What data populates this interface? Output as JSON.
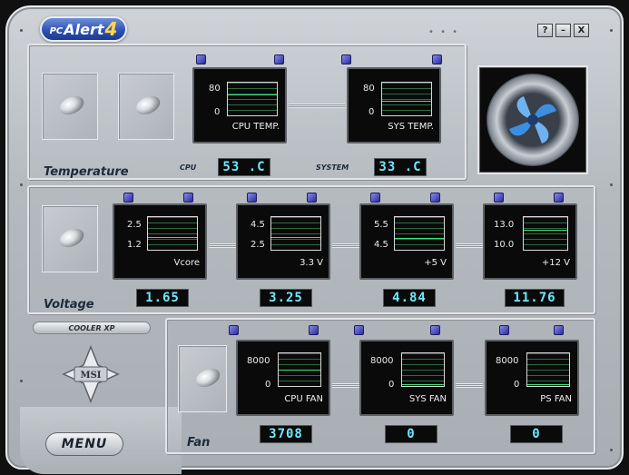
{
  "app": {
    "logo_prefix": "PC",
    "logo_name": "Alert",
    "logo_version": "4",
    "help_label": "?",
    "minimize_label": "–",
    "close_label": "X"
  },
  "temperature": {
    "title": "Temperature",
    "cpu_caption": "CPU",
    "system_caption": "SYSTEM",
    "monitors": [
      {
        "hi": "80",
        "lo": "0",
        "label": "CPU TEMP.",
        "trace_level": 0.62
      },
      {
        "hi": "80",
        "lo": "0",
        "label": "SYS TEMP.",
        "trace_level": 0.41
      }
    ],
    "cpu_value": "53 .C",
    "system_value": "33 .C"
  },
  "voltage": {
    "title": "Voltage",
    "monitors": [
      {
        "hi": "2.5",
        "lo": "1.2",
        "label": "Vcore",
        "value": "1.65",
        "trace_level": 0.35
      },
      {
        "hi": "4.5",
        "lo": "2.5",
        "label": "3.3 V",
        "value": "3.25",
        "trace_level": 0.37
      },
      {
        "hi": "5.5",
        "lo": "4.5",
        "label": "+5 V",
        "value": "4.84",
        "trace_level": 0.34
      },
      {
        "hi": "13.0",
        "lo": "10.0",
        "label": "+12 V",
        "value": "11.76",
        "trace_level": 0.58
      }
    ]
  },
  "fan": {
    "title": "Fan",
    "monitors": [
      {
        "hi": "8000",
        "lo": "0",
        "label": "CPU FAN",
        "value": "3708",
        "trace_level": 0.46
      },
      {
        "hi": "8000",
        "lo": "0",
        "label": "SYS FAN",
        "value": "0",
        "trace_level": 0.0
      },
      {
        "hi": "8000",
        "lo": "0",
        "label": "PS FAN",
        "value": "0",
        "trace_level": 0.0
      }
    ]
  },
  "side": {
    "cooler_label": "COOLER XP",
    "msi_label": "MSI",
    "menu_label": "MENU"
  },
  "colors": {
    "trace": "#3fe07a",
    "readout": "#6ee8ff",
    "logo_blue": "#2a4eb3",
    "fan_blue": "#3c8fe0"
  }
}
